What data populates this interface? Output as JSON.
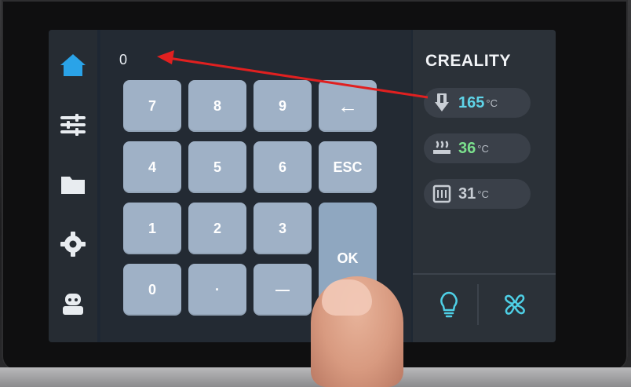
{
  "entry": {
    "value": "0"
  },
  "keypad": {
    "keys": [
      "7",
      "8",
      "9",
      "←",
      "4",
      "5",
      "6",
      "ESC",
      "1",
      "2",
      "3",
      "0",
      "·",
      "—"
    ],
    "ok_label": "OK"
  },
  "nav": {
    "items": [
      {
        "icon": "home-icon"
      },
      {
        "icon": "tune-icon"
      },
      {
        "icon": "folder-icon"
      },
      {
        "icon": "gear-icon"
      },
      {
        "icon": "robot-icon"
      }
    ]
  },
  "status": {
    "brand": "CREALITY",
    "nozzle": {
      "icon": "nozzle-icon",
      "value": "165",
      "unit": "°C",
      "color": "#5fd4e8"
    },
    "bed": {
      "icon": "bed-icon",
      "value": "36",
      "unit": "°C",
      "color": "#7be08d"
    },
    "chamber": {
      "icon": "chamber-icon",
      "value": "31",
      "unit": "°C",
      "color": "#c9ced5"
    }
  },
  "panel_buttons": [
    {
      "icon": "light-bulb-icon"
    },
    {
      "icon": "fan-icon"
    }
  ],
  "colors": {
    "accent_home": "#2aa3e8",
    "arrow": "#e02020"
  }
}
